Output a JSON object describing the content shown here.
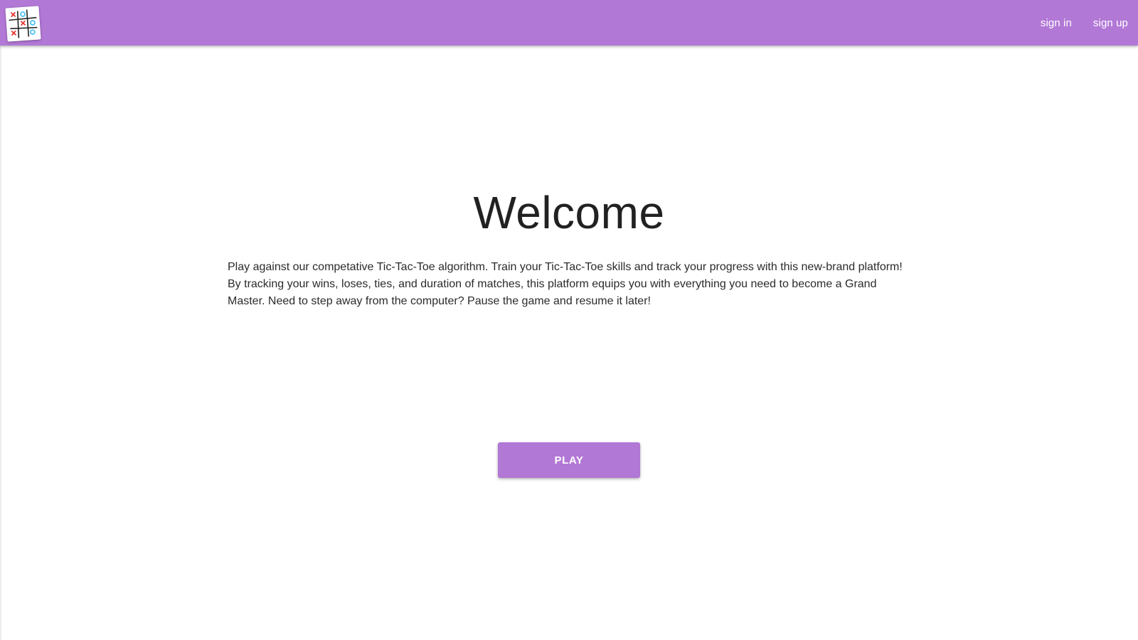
{
  "header": {
    "logo_icon": "tic-tac-toe-logo-icon",
    "links": [
      {
        "label": "sign in"
      },
      {
        "label": "sign up"
      }
    ]
  },
  "main": {
    "title": "Welcome",
    "description": "Play against our competative Tic-Tac-Toe algorithm. Train your Tic-Tac-Toe skills and track your progress with this new-brand platform! By tracking your wins, loses, ties, and duration of matches, this platform equips you with everything you need to become a Grand Master. Need to step away from the computer? Pause the game and resume it later!",
    "play_label": "PLAY"
  },
  "colors": {
    "brand": "#b278d6",
    "text": "#212121",
    "background": "#ffffff"
  }
}
